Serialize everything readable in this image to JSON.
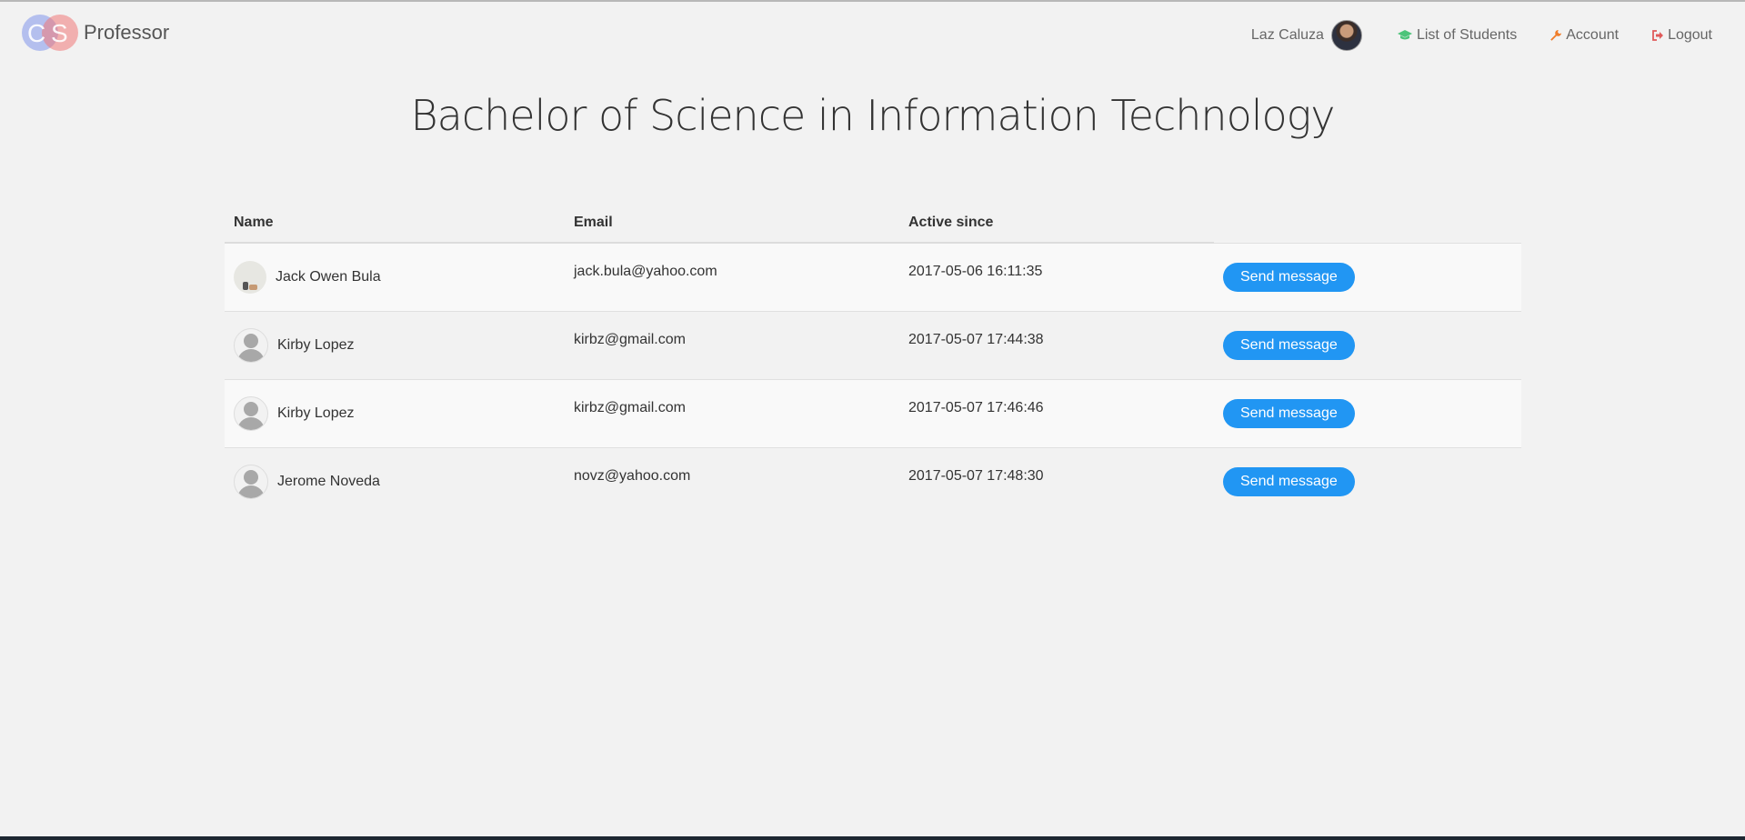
{
  "brand": {
    "name": "Professor",
    "logo_letters": [
      "C",
      "S"
    ]
  },
  "nav": {
    "user_name": "Laz Caluza",
    "links": [
      {
        "label": "List of Students",
        "icon": "graduation-cap-icon",
        "icon_color": "#4cc47a"
      },
      {
        "label": "Account",
        "icon": "wrench-icon",
        "icon_color": "#f07d2a"
      },
      {
        "label": "Logout",
        "icon": "sign-out-icon",
        "icon_color": "#e05a5a"
      }
    ]
  },
  "page_title": "Bachelor of Science in Information Technology",
  "table": {
    "headers": {
      "name": "Name",
      "email": "Email",
      "active_since": "Active since"
    },
    "rows": [
      {
        "name": "Jack Owen Bula",
        "email": "jack.bula@yahoo.com",
        "active_since": "2017-05-06 16:11:35",
        "action": "Send message"
      },
      {
        "name": "Kirby Lopez",
        "email": "kirbz@gmail.com",
        "active_since": "2017-05-07 17:44:38",
        "action": "Send message"
      },
      {
        "name": "Kirby Lopez",
        "email": "kirbz@gmail.com",
        "active_since": "2017-05-07 17:46:46",
        "action": "Send message"
      },
      {
        "name": "Jerome Noveda",
        "email": "novz@yahoo.com",
        "active_since": "2017-05-07 17:48:30",
        "action": "Send message"
      }
    ]
  },
  "colors": {
    "accent": "#2196f3",
    "background": "#f2f2f2"
  }
}
